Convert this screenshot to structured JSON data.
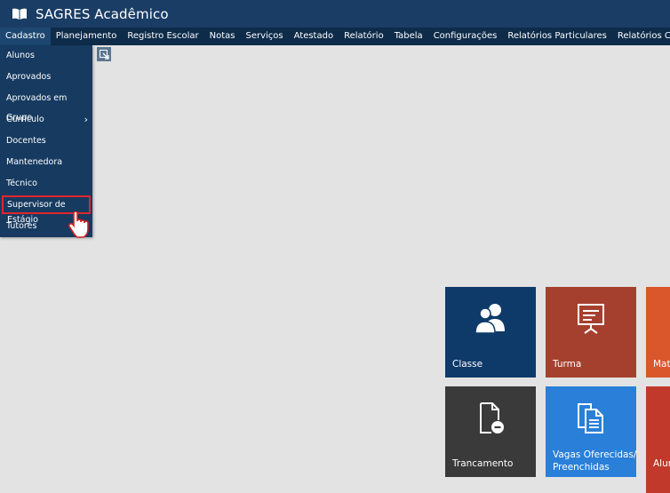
{
  "app": {
    "title": "SAGRES Acadêmico"
  },
  "menu": [
    "Cadastro",
    "Planejamento",
    "Registro Escolar",
    "Notas",
    "Serviços",
    "Atestado",
    "Relatório",
    "Tabela",
    "Configurações",
    "Relatórios Particulares",
    "Relatórios Complementares"
  ],
  "dropdown": {
    "items": [
      "Alunos",
      "Aprovados",
      "Aprovados em Grupo",
      "Currículo",
      "Docentes",
      "Mantenedora",
      "Técnico",
      "Supervisor de Estágio",
      "Tutores"
    ],
    "submenu_chevron": "›"
  },
  "tiles": {
    "classe": {
      "label": "Classe",
      "color": "#0e3a6a",
      "icon": "users-icon"
    },
    "turma": {
      "label": "Turma",
      "color": "#a6402e",
      "icon": "presentation-icon"
    },
    "mat": {
      "label": "Mat",
      "color": "#d9572b"
    },
    "trancamento": {
      "label": "Trancamento",
      "color": "#3a3a3a",
      "icon": "document-minus-icon"
    },
    "vagas": {
      "label_line1": "Vagas Oferecidas/",
      "label_line2": "Preenchidas",
      "color": "#2a7fd9",
      "icon": "documents-icon"
    },
    "alun": {
      "label": "Alun",
      "color": "#c0392b"
    }
  }
}
